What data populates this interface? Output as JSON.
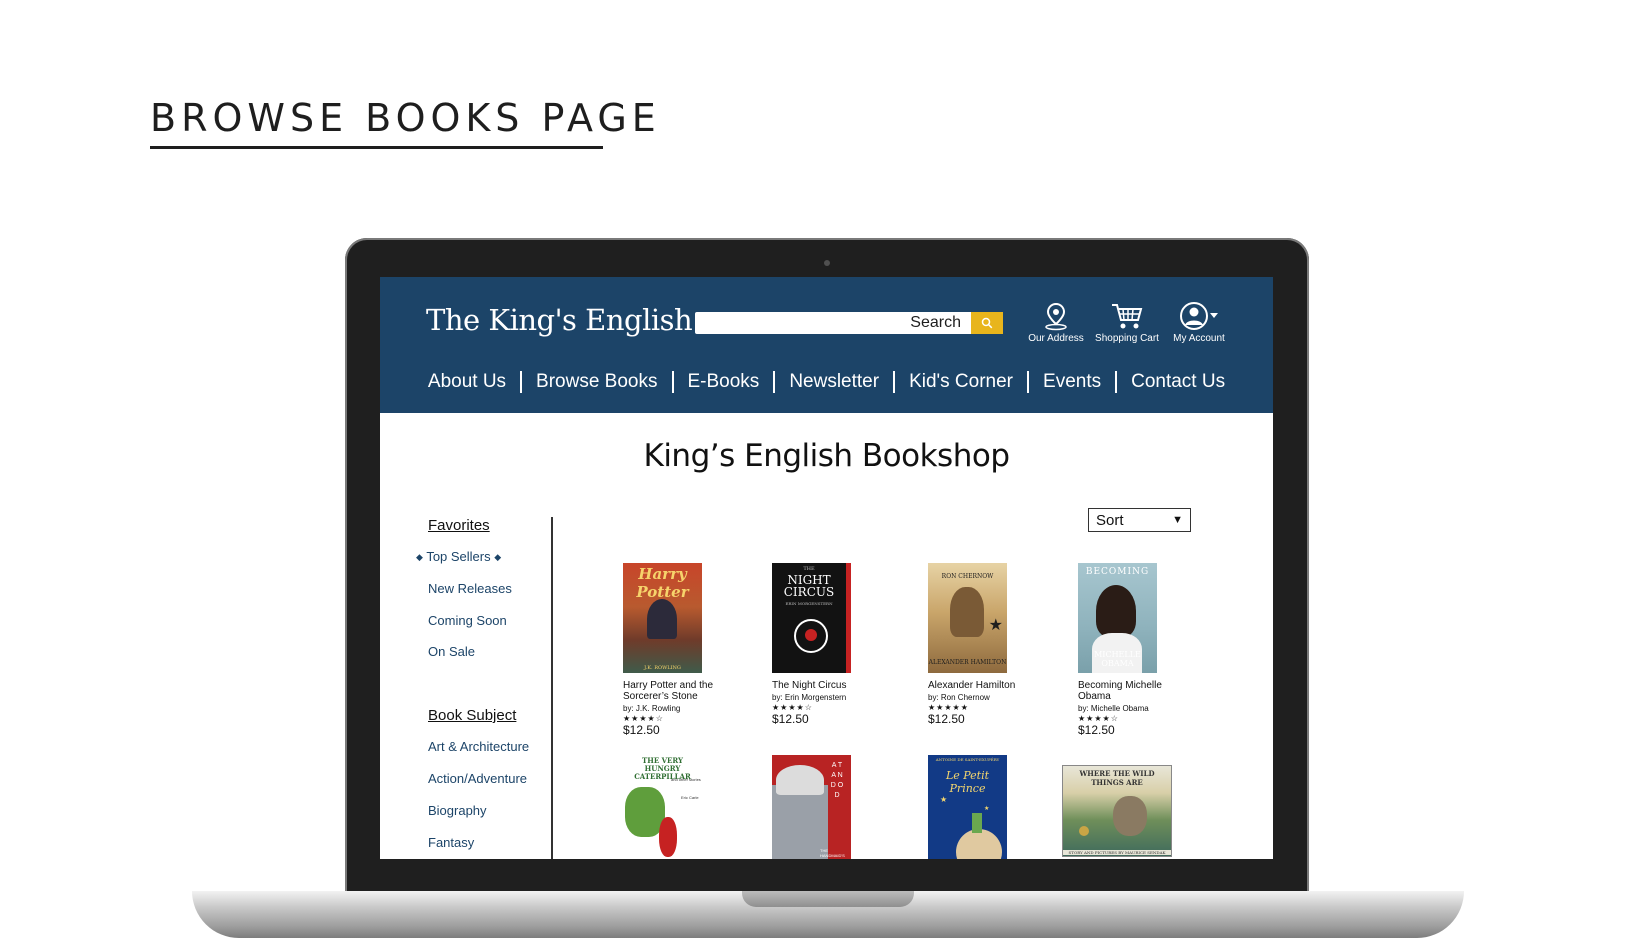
{
  "page_heading": "BROWSE BOOKS PAGE",
  "site": {
    "logo": "The King's English",
    "search": {
      "placeholder": "Search"
    },
    "header_icons": [
      {
        "label": "Our Address",
        "icon": "location-pin-icon"
      },
      {
        "label": "Shopping Cart",
        "icon": "shopping-cart-icon"
      },
      {
        "label": "My Account",
        "icon": "account-icon"
      }
    ],
    "nav": [
      "About Us",
      "Browse Books",
      "E-Books",
      "Newsletter",
      "Kid's Corner",
      "Events",
      "Contact Us"
    ],
    "title": "King’s English Bookshop"
  },
  "sidebar": {
    "favorites": {
      "heading": "Favorites",
      "items": [
        "Top Sellers",
        "New Releases",
        "Coming Soon",
        "On Sale"
      ]
    },
    "subjects": {
      "heading": "Book Subject",
      "items": [
        "Art & Architecture",
        "Action/Adventure",
        "Biography",
        "Fantasy"
      ]
    }
  },
  "sort": {
    "label": "Sort"
  },
  "books": [
    {
      "title": "Harry Potter and the Sorcerer’s Stone",
      "author": "by: J.K. Rowling",
      "stars": "★★★★☆",
      "price": "$12.50",
      "cover_title": "Harry Potter",
      "cover_sub": "",
      "cover_author": "J.K. ROWLING"
    },
    {
      "title": "The Night Circus",
      "author": "by: Erin Morgenstern",
      "stars": "★★★★☆",
      "price": "$12.50",
      "cover_title": "NIGHT CIRCUS",
      "cover_sub": "THE",
      "cover_author": "ERIN MORGENSTERN"
    },
    {
      "title": "Alexander Hamilton",
      "author": "by: Ron Chernow",
      "stars": "★★★★★",
      "price": "$12.50",
      "cover_title": "ALEXANDER HAMILTON",
      "cover_sub": "",
      "cover_author": "RON CHERNOW"
    },
    {
      "title": "Becoming Michelle Obama",
      "author": "by: Michelle Obama",
      "stars": "★★★★☆",
      "price": "$12.50",
      "cover_title": "BECOMING",
      "cover_sub": "",
      "cover_author": "MICHELLE OBAMA"
    },
    {
      "cover_title": "THE VERY HUNGRY CATERPILLAR",
      "cover_sub": "and other stories",
      "cover_author": "Eric Carle"
    },
    {
      "cover_title": "A T A N D O D",
      "cover_sub": "",
      "cover_author": "THE HANDMAID'S TALE"
    },
    {
      "cover_title": "Le Petit Prince",
      "cover_sub": "",
      "cover_author": "ANTOINE DE SAINT-EXUPÉRY"
    },
    {
      "cover_title": "WHERE THE WILD THINGS ARE",
      "cover_sub": "",
      "cover_author": "STORY AND PICTURES BY MAURICE SENDAK"
    }
  ]
}
